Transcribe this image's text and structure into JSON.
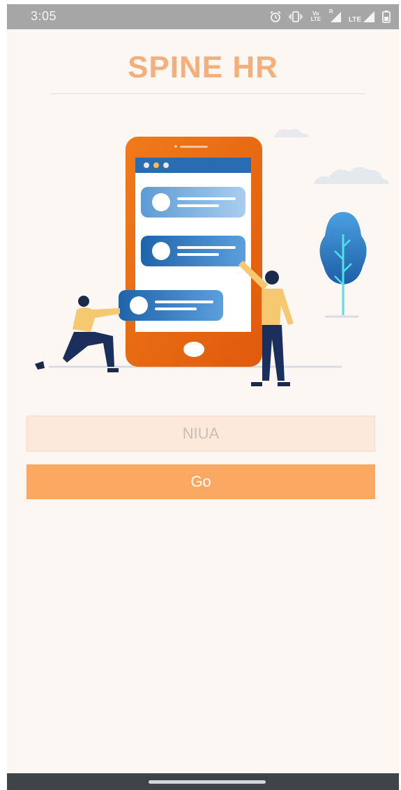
{
  "status_bar": {
    "time": "3:05",
    "icons": [
      "alarm-icon",
      "vibrate-icon",
      "volte-icon",
      "signal-roaming-icon",
      "lte-signal-icon",
      "battery-icon"
    ],
    "volte_label": "Vo LTE",
    "lte_label": "LTE",
    "roaming_label": "R"
  },
  "header": {
    "title": "SPINE HR"
  },
  "form": {
    "code_input": {
      "value": "",
      "placeholder": "NIUA"
    },
    "go_label": "Go"
  },
  "colors": {
    "accent": "#fba863",
    "title": "#f4b07c",
    "input_bg": "#fde9dc",
    "background": "#fdf7f4"
  }
}
